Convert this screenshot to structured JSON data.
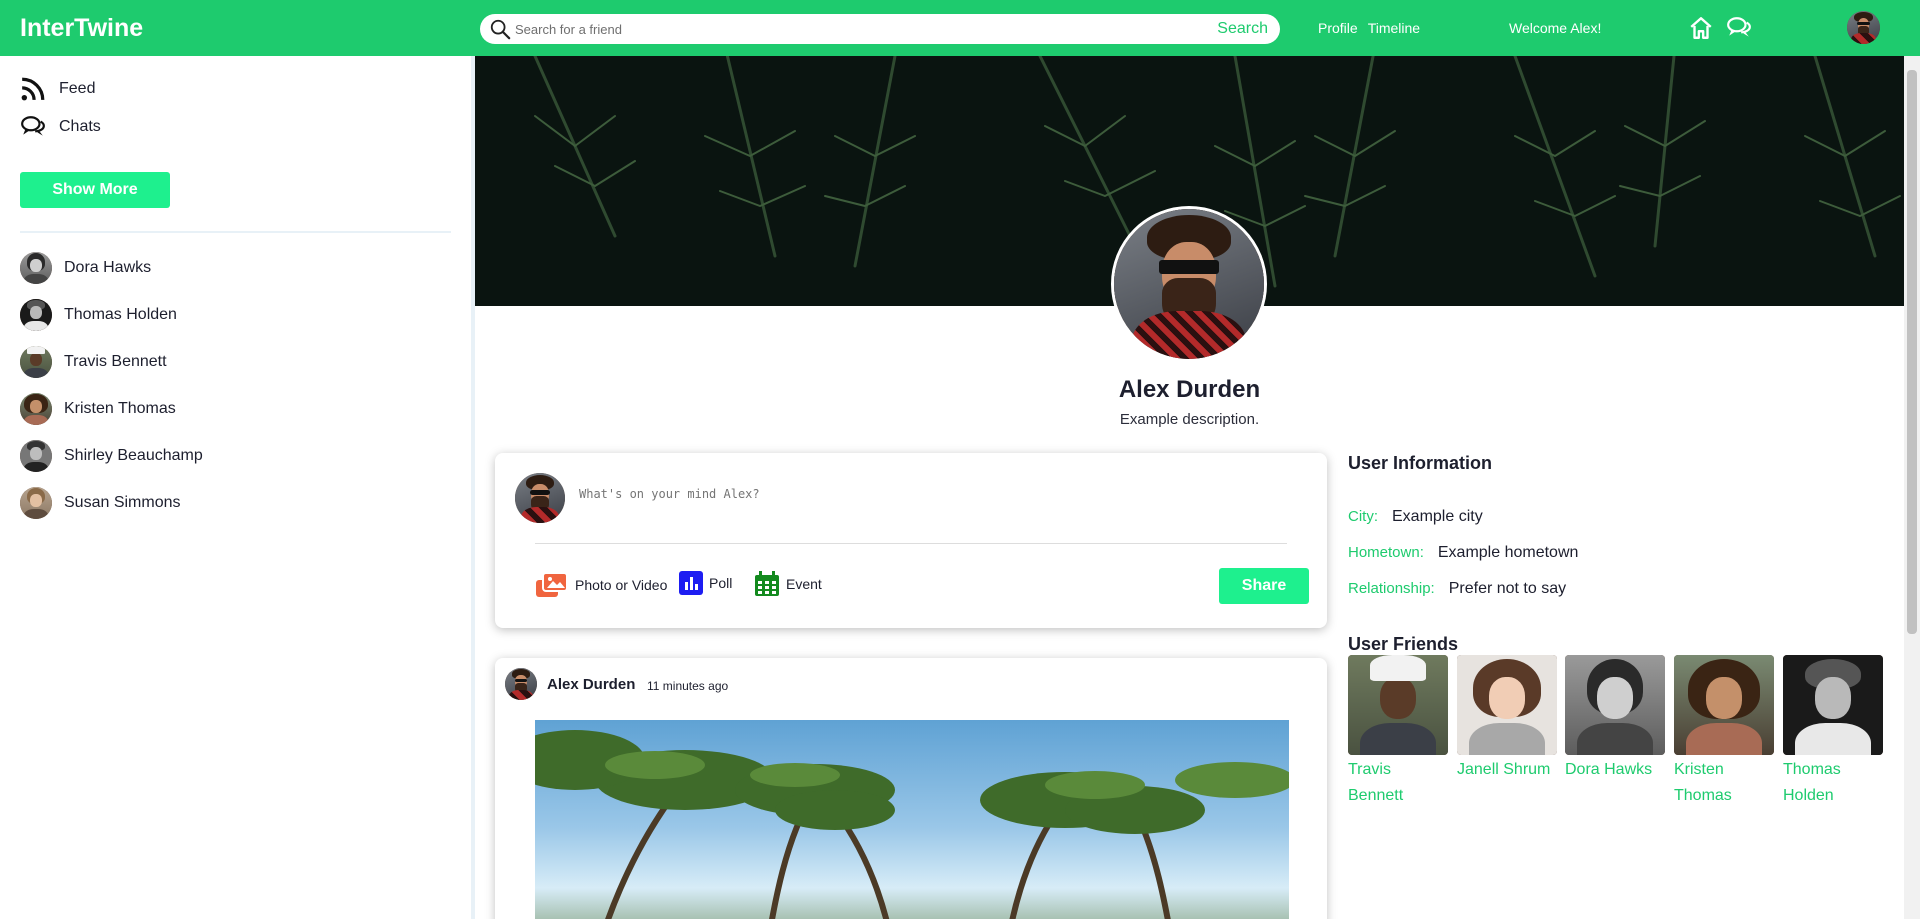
{
  "app": {
    "name": "InterTwine"
  },
  "search": {
    "placeholder": "Search for a friend",
    "button": "Search"
  },
  "nav": {
    "profile": "Profile",
    "timeline": "Timeline",
    "welcome": "Welcome Alex!"
  },
  "icons": {
    "home": "home-icon",
    "chat": "chat-bubbles-icon",
    "feed": "rss-icon",
    "search": "search-icon"
  },
  "colors": {
    "brand": "#1ecb6e",
    "button": "#1ef08e"
  },
  "sidebar": {
    "feed": "Feed",
    "chats": "Chats",
    "show_more": "Show More",
    "friends": [
      "Dora Hawks",
      "Thomas Holden",
      "Travis Bennett",
      "Kristen Thomas",
      "Shirley Beauchamp",
      "Susan Simmons"
    ]
  },
  "profile": {
    "name": "Alex Durden",
    "description": "Example description."
  },
  "share": {
    "placeholder": "What's on your mind Alex?",
    "photo": "Photo or Video",
    "poll": "Poll",
    "event": "Event",
    "button": "Share"
  },
  "post": {
    "author": "Alex Durden",
    "time": "11 minutes ago"
  },
  "user_info": {
    "title": "User Information",
    "city_label": "City:",
    "city": "Example city",
    "hometown_label": "Hometown:",
    "hometown": "Example hometown",
    "relationship_label": "Relationship:",
    "relationship": "Prefer not to say"
  },
  "user_friends": {
    "title": "User Friends",
    "items": [
      "Travis Bennett",
      "Janell Shrum",
      "Dora Hawks",
      "Kristen Thomas",
      "Thomas Holden"
    ]
  }
}
